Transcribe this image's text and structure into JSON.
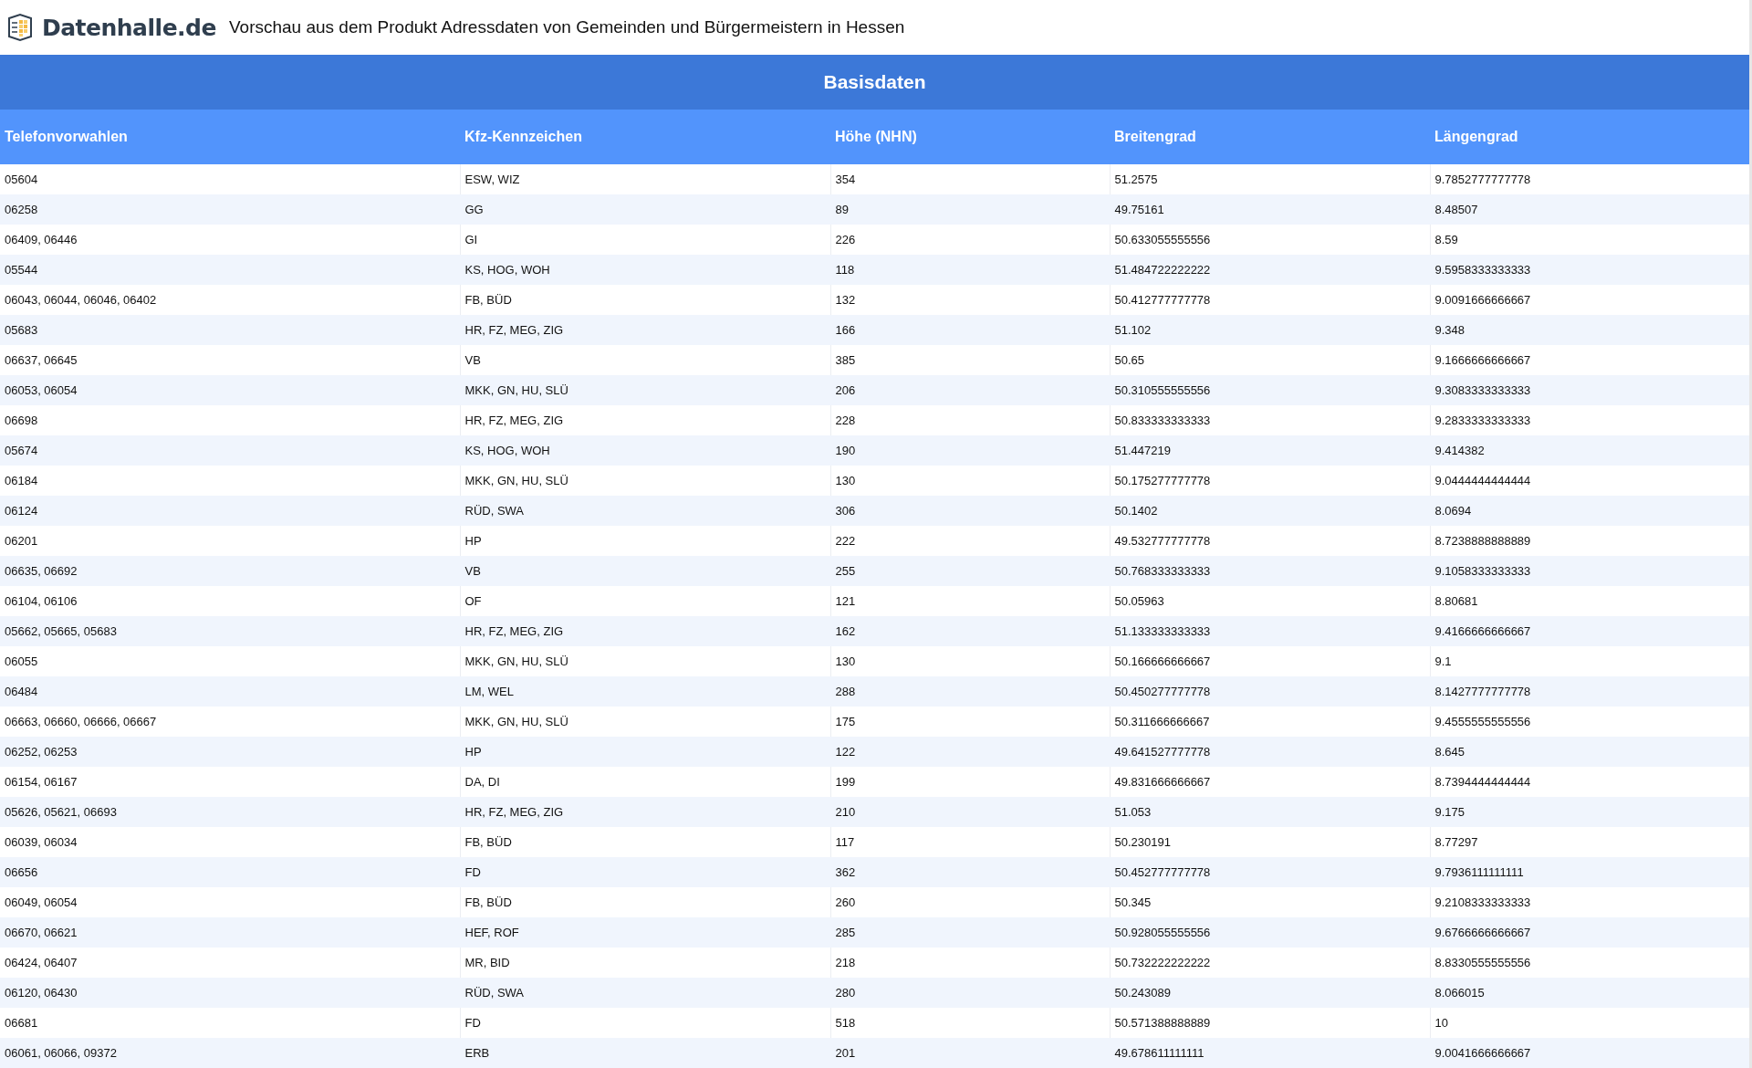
{
  "header": {
    "logo_text": "Datenhalle.de",
    "title": "Vorschau aus dem Produkt Adressdaten von Gemeinden und Bürgermeistern in Hessen"
  },
  "section_title": "Basisdaten",
  "table": {
    "columns": [
      "Telefonvorwahlen",
      "Kfz-Kennzeichen",
      "Höhe (NHN)",
      "Breitengrad",
      "Längengrad"
    ],
    "rows": [
      [
        "05604",
        "ESW, WIZ",
        "354",
        "51.2575",
        "9.7852777777778"
      ],
      [
        "06258",
        "GG",
        "89",
        "49.75161",
        "8.48507"
      ],
      [
        "06409, 06446",
        "GI",
        "226",
        "50.633055555556",
        "8.59"
      ],
      [
        "05544",
        "KS, HOG, WOH",
        "118",
        "51.484722222222",
        "9.5958333333333"
      ],
      [
        "06043, 06044, 06046, 06402",
        "FB, BÜD",
        "132",
        "50.412777777778",
        "9.0091666666667"
      ],
      [
        "05683",
        "HR, FZ, MEG, ZIG",
        "166",
        "51.102",
        "9.348"
      ],
      [
        "06637, 06645",
        "VB",
        "385",
        "50.65",
        "9.1666666666667"
      ],
      [
        "06053, 06054",
        "MKK, GN, HU, SLÜ",
        "206",
        "50.310555555556",
        "9.3083333333333"
      ],
      [
        "06698",
        "HR, FZ, MEG, ZIG",
        "228",
        "50.833333333333",
        "9.2833333333333"
      ],
      [
        "05674",
        "KS, HOG, WOH",
        "190",
        "51.447219",
        "9.414382"
      ],
      [
        "06184",
        "MKK, GN, HU, SLÜ",
        "130",
        "50.175277777778",
        "9.0444444444444"
      ],
      [
        "06124",
        "RÜD, SWA",
        "306",
        "50.1402",
        "8.0694"
      ],
      [
        "06201",
        "HP",
        "222",
        "49.532777777778",
        "8.7238888888889"
      ],
      [
        "06635, 06692",
        "VB",
        "255",
        "50.768333333333",
        "9.1058333333333"
      ],
      [
        "06104, 06106",
        "OF",
        "121",
        "50.05963",
        "8.80681"
      ],
      [
        "05662, 05665, 05683",
        "HR, FZ, MEG, ZIG",
        "162",
        "51.133333333333",
        "9.4166666666667"
      ],
      [
        "06055",
        "MKK, GN, HU, SLÜ",
        "130",
        "50.166666666667",
        "9.1"
      ],
      [
        "06484",
        "LM, WEL",
        "288",
        "50.450277777778",
        "8.1427777777778"
      ],
      [
        "06663, 06660, 06666, 06667",
        "MKK, GN, HU, SLÜ",
        "175",
        "50.311666666667",
        "9.4555555555556"
      ],
      [
        "06252, 06253",
        "HP",
        "122",
        "49.641527777778",
        "8.645"
      ],
      [
        "06154, 06167",
        "DA, DI",
        "199",
        "49.831666666667",
        "8.7394444444444"
      ],
      [
        "05626, 05621, 06693",
        "HR, FZ, MEG, ZIG",
        "210",
        "51.053",
        "9.175"
      ],
      [
        "06039, 06034",
        "FB, BÜD",
        "117",
        "50.230191",
        "8.77297"
      ],
      [
        "06656",
        "FD",
        "362",
        "50.452777777778",
        "9.7936111111111"
      ],
      [
        "06049, 06054",
        "FB, BÜD",
        "260",
        "50.345",
        "9.2108333333333"
      ],
      [
        "06670, 06621",
        "HEF, ROF",
        "285",
        "50.928055555556",
        "9.6766666666667"
      ],
      [
        "06424, 06407",
        "MR, BID",
        "218",
        "50.732222222222",
        "8.8330555555556"
      ],
      [
        "06120, 06430",
        "RÜD, SWA",
        "280",
        "50.243089",
        "8.066015"
      ],
      [
        "06681",
        "FD",
        "518",
        "50.571388888889",
        "10"
      ],
      [
        "06061, 06066, 09372",
        "ERB",
        "201",
        "49.678611111111",
        "9.0041666666667"
      ]
    ]
  }
}
